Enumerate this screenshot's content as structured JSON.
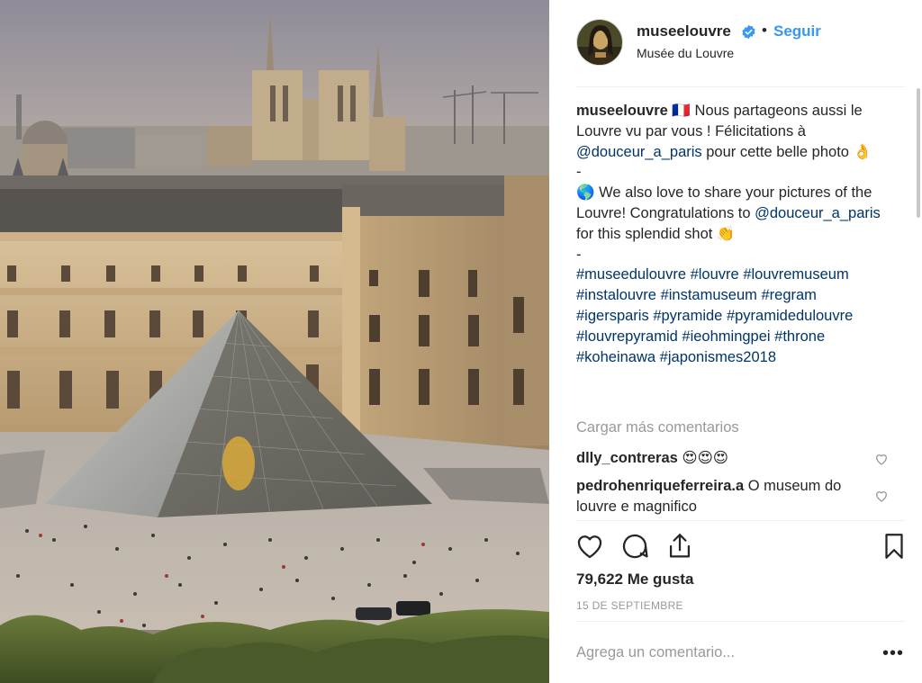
{
  "header": {
    "username": "museelouvre",
    "dot": "•",
    "follow_label": "Seguir",
    "location": "Musée du Louvre"
  },
  "caption": {
    "username": "museelouvre",
    "flag": "🇫🇷",
    "fr_text_1": " Nous partageons aussi le Louvre vu par vous ! Félicitations à ",
    "mention_1": "@douceur_a_paris",
    "fr_text_2": " pour cette belle photo ",
    "emoji_1": "👌",
    "dash_1": "-",
    "globe": "🌎",
    "en_text_1": " We also love to share your pictures of the Louvre! Congratulations to ",
    "mention_2": "@douceur_a_paris",
    "en_text_2": " for this splendid shot ",
    "emoji_2": "👏",
    "dash_2": "-",
    "hashtags": [
      "#museedulouvre",
      "#louvre",
      "#louvremuseum",
      "#instalouvre",
      "#instamuseum",
      "#regram",
      "#igersparis",
      "#pyramide",
      "#pyramidedulouvre",
      "#louvrepyramid",
      "#ieohmingpei",
      "#throne",
      "#koheinawa",
      "#japonismes2018"
    ]
  },
  "load_more_label": "Cargar más comentarios",
  "comments": [
    {
      "username": "dlly_contreras",
      "text": " 😍😍😍"
    },
    {
      "username": "pedrohenriqueferreira.a",
      "text": " O museum do louvre e magnifico"
    }
  ],
  "likes_label": "79,622 Me gusta",
  "date_label": "15 DE SEPTIEMBRE",
  "add_comment_placeholder": "Agrega un comentario...",
  "more_options": "•••",
  "icons": {
    "verified": "verified-badge-icon",
    "like": "heart-icon",
    "comment": "comment-bubble-icon",
    "share": "share-icon",
    "save": "bookmark-icon",
    "comment_like": "small-heart-icon"
  },
  "colors": {
    "link": "#3897f0",
    "mention": "#003569",
    "muted": "#999999",
    "text": "#262626"
  }
}
